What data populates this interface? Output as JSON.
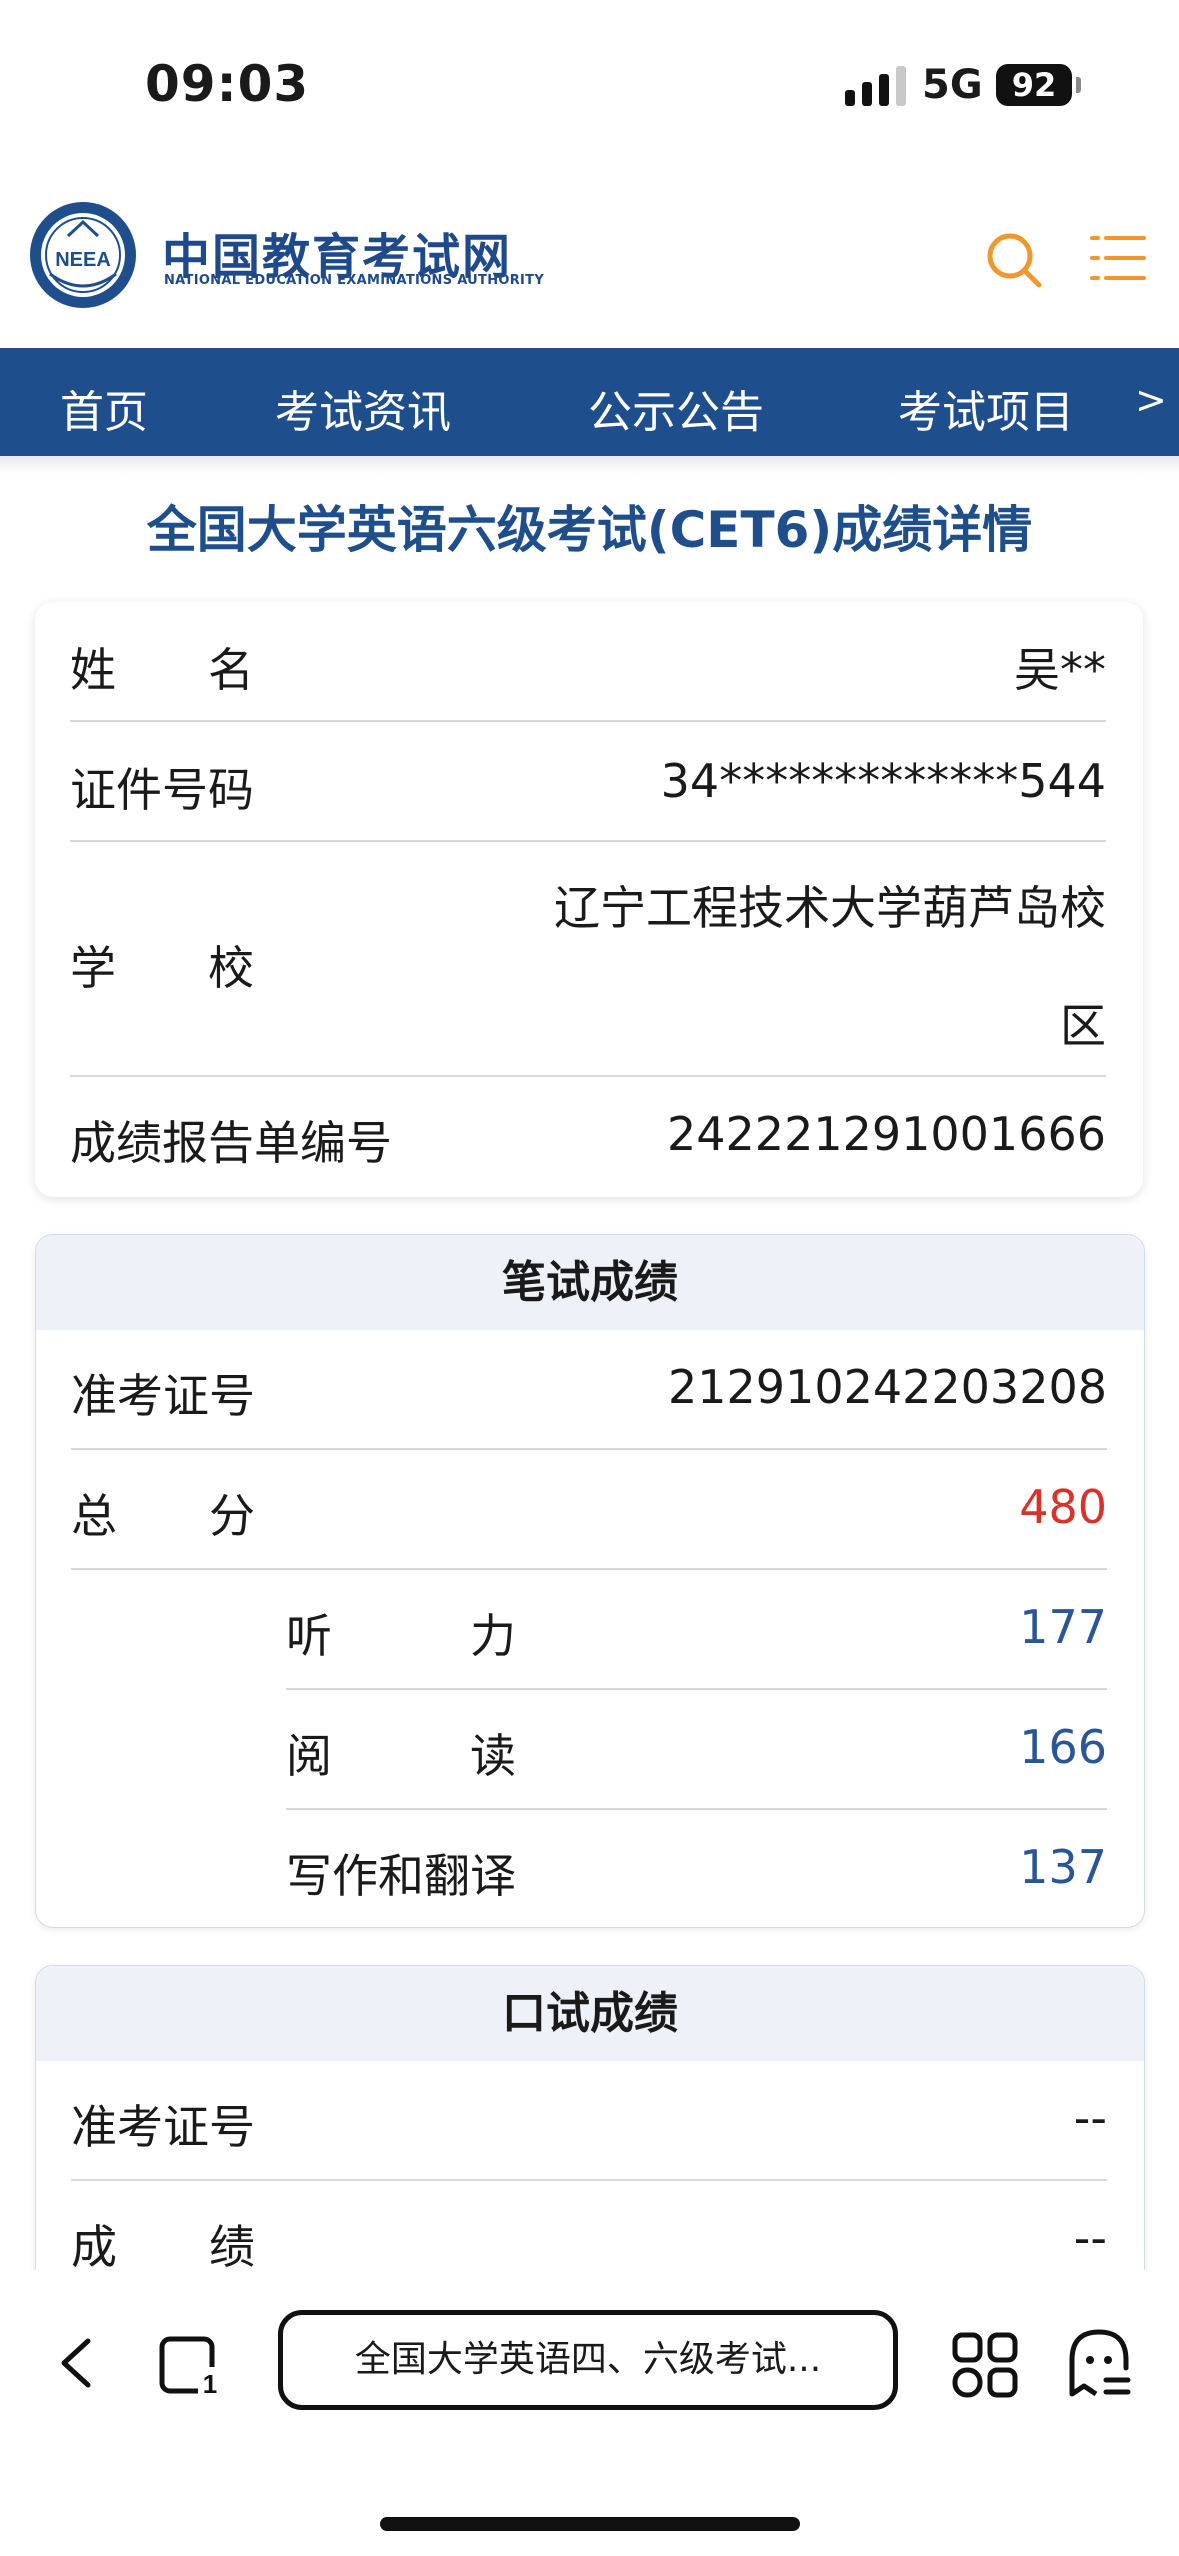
{
  "status_bar": {
    "time": "09:03",
    "network": "5G",
    "battery": "92"
  },
  "header": {
    "logo_cn": "中国教育考试网",
    "logo_en": "NATIONAL EDUCATION EXAMINATIONS AUTHORITY",
    "emblem_text": "NEEA",
    "accent_color": "#f0982d",
    "brand_color": "#1f4e8c"
  },
  "nav": {
    "items": [
      "首页",
      "考试资讯",
      "公示公告",
      "考试项目"
    ],
    "more": ">"
  },
  "page_title": "全国大学英语六级考试(CET6)成绩详情",
  "info": {
    "name_label": "姓　　名",
    "name_value": "吴**",
    "id_label": "证件号码",
    "id_value": "34*************544",
    "school_label": "学　　校",
    "school_value_line1": "辽宁工程技术大学葫芦岛校",
    "school_value_line2": "区",
    "report_label": "成绩报告单编号",
    "report_value": "242221291001666"
  },
  "written": {
    "title": "笔试成绩",
    "ticket_label": "准考证号",
    "ticket_value": "212910242203208",
    "total_label": "总　　分",
    "total_value": "480",
    "listening_label": "听　　　力",
    "listening_value": "177",
    "reading_label": "阅　　　读",
    "reading_value": "166",
    "writing_label": "写作和翻译",
    "writing_value": "137"
  },
  "oral": {
    "title": "口试成绩",
    "ticket_label": "准考证号",
    "ticket_value": "--",
    "score_label": "成　　绩",
    "score_value": "--"
  },
  "toolbar": {
    "address": "全国大学英语四、六级考试...",
    "tab_count": "1"
  }
}
